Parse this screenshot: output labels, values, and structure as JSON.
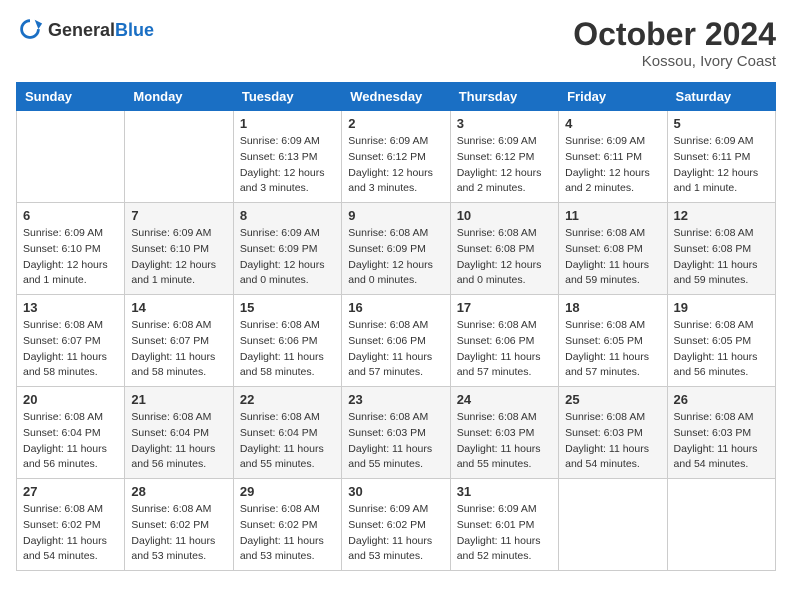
{
  "logo": {
    "general": "General",
    "blue": "Blue"
  },
  "header": {
    "month": "October 2024",
    "location": "Kossou, Ivory Coast"
  },
  "weekdays": [
    "Sunday",
    "Monday",
    "Tuesday",
    "Wednesday",
    "Thursday",
    "Friday",
    "Saturday"
  ],
  "weeks": [
    [
      {
        "day": "",
        "sunrise": "",
        "sunset": "",
        "daylight": ""
      },
      {
        "day": "",
        "sunrise": "",
        "sunset": "",
        "daylight": ""
      },
      {
        "day": "1",
        "sunrise": "Sunrise: 6:09 AM",
        "sunset": "Sunset: 6:13 PM",
        "daylight": "Daylight: 12 hours and 3 minutes."
      },
      {
        "day": "2",
        "sunrise": "Sunrise: 6:09 AM",
        "sunset": "Sunset: 6:12 PM",
        "daylight": "Daylight: 12 hours and 3 minutes."
      },
      {
        "day": "3",
        "sunrise": "Sunrise: 6:09 AM",
        "sunset": "Sunset: 6:12 PM",
        "daylight": "Daylight: 12 hours and 2 minutes."
      },
      {
        "day": "4",
        "sunrise": "Sunrise: 6:09 AM",
        "sunset": "Sunset: 6:11 PM",
        "daylight": "Daylight: 12 hours and 2 minutes."
      },
      {
        "day": "5",
        "sunrise": "Sunrise: 6:09 AM",
        "sunset": "Sunset: 6:11 PM",
        "daylight": "Daylight: 12 hours and 1 minute."
      }
    ],
    [
      {
        "day": "6",
        "sunrise": "Sunrise: 6:09 AM",
        "sunset": "Sunset: 6:10 PM",
        "daylight": "Daylight: 12 hours and 1 minute."
      },
      {
        "day": "7",
        "sunrise": "Sunrise: 6:09 AM",
        "sunset": "Sunset: 6:10 PM",
        "daylight": "Daylight: 12 hours and 1 minute."
      },
      {
        "day": "8",
        "sunrise": "Sunrise: 6:09 AM",
        "sunset": "Sunset: 6:09 PM",
        "daylight": "Daylight: 12 hours and 0 minutes."
      },
      {
        "day": "9",
        "sunrise": "Sunrise: 6:08 AM",
        "sunset": "Sunset: 6:09 PM",
        "daylight": "Daylight: 12 hours and 0 minutes."
      },
      {
        "day": "10",
        "sunrise": "Sunrise: 6:08 AM",
        "sunset": "Sunset: 6:08 PM",
        "daylight": "Daylight: 12 hours and 0 minutes."
      },
      {
        "day": "11",
        "sunrise": "Sunrise: 6:08 AM",
        "sunset": "Sunset: 6:08 PM",
        "daylight": "Daylight: 11 hours and 59 minutes."
      },
      {
        "day": "12",
        "sunrise": "Sunrise: 6:08 AM",
        "sunset": "Sunset: 6:08 PM",
        "daylight": "Daylight: 11 hours and 59 minutes."
      }
    ],
    [
      {
        "day": "13",
        "sunrise": "Sunrise: 6:08 AM",
        "sunset": "Sunset: 6:07 PM",
        "daylight": "Daylight: 11 hours and 58 minutes."
      },
      {
        "day": "14",
        "sunrise": "Sunrise: 6:08 AM",
        "sunset": "Sunset: 6:07 PM",
        "daylight": "Daylight: 11 hours and 58 minutes."
      },
      {
        "day": "15",
        "sunrise": "Sunrise: 6:08 AM",
        "sunset": "Sunset: 6:06 PM",
        "daylight": "Daylight: 11 hours and 58 minutes."
      },
      {
        "day": "16",
        "sunrise": "Sunrise: 6:08 AM",
        "sunset": "Sunset: 6:06 PM",
        "daylight": "Daylight: 11 hours and 57 minutes."
      },
      {
        "day": "17",
        "sunrise": "Sunrise: 6:08 AM",
        "sunset": "Sunset: 6:06 PM",
        "daylight": "Daylight: 11 hours and 57 minutes."
      },
      {
        "day": "18",
        "sunrise": "Sunrise: 6:08 AM",
        "sunset": "Sunset: 6:05 PM",
        "daylight": "Daylight: 11 hours and 57 minutes."
      },
      {
        "day": "19",
        "sunrise": "Sunrise: 6:08 AM",
        "sunset": "Sunset: 6:05 PM",
        "daylight": "Daylight: 11 hours and 56 minutes."
      }
    ],
    [
      {
        "day": "20",
        "sunrise": "Sunrise: 6:08 AM",
        "sunset": "Sunset: 6:04 PM",
        "daylight": "Daylight: 11 hours and 56 minutes."
      },
      {
        "day": "21",
        "sunrise": "Sunrise: 6:08 AM",
        "sunset": "Sunset: 6:04 PM",
        "daylight": "Daylight: 11 hours and 56 minutes."
      },
      {
        "day": "22",
        "sunrise": "Sunrise: 6:08 AM",
        "sunset": "Sunset: 6:04 PM",
        "daylight": "Daylight: 11 hours and 55 minutes."
      },
      {
        "day": "23",
        "sunrise": "Sunrise: 6:08 AM",
        "sunset": "Sunset: 6:03 PM",
        "daylight": "Daylight: 11 hours and 55 minutes."
      },
      {
        "day": "24",
        "sunrise": "Sunrise: 6:08 AM",
        "sunset": "Sunset: 6:03 PM",
        "daylight": "Daylight: 11 hours and 55 minutes."
      },
      {
        "day": "25",
        "sunrise": "Sunrise: 6:08 AM",
        "sunset": "Sunset: 6:03 PM",
        "daylight": "Daylight: 11 hours and 54 minutes."
      },
      {
        "day": "26",
        "sunrise": "Sunrise: 6:08 AM",
        "sunset": "Sunset: 6:03 PM",
        "daylight": "Daylight: 11 hours and 54 minutes."
      }
    ],
    [
      {
        "day": "27",
        "sunrise": "Sunrise: 6:08 AM",
        "sunset": "Sunset: 6:02 PM",
        "daylight": "Daylight: 11 hours and 54 minutes."
      },
      {
        "day": "28",
        "sunrise": "Sunrise: 6:08 AM",
        "sunset": "Sunset: 6:02 PM",
        "daylight": "Daylight: 11 hours and 53 minutes."
      },
      {
        "day": "29",
        "sunrise": "Sunrise: 6:08 AM",
        "sunset": "Sunset: 6:02 PM",
        "daylight": "Daylight: 11 hours and 53 minutes."
      },
      {
        "day": "30",
        "sunrise": "Sunrise: 6:09 AM",
        "sunset": "Sunset: 6:02 PM",
        "daylight": "Daylight: 11 hours and 53 minutes."
      },
      {
        "day": "31",
        "sunrise": "Sunrise: 6:09 AM",
        "sunset": "Sunset: 6:01 PM",
        "daylight": "Daylight: 11 hours and 52 minutes."
      },
      {
        "day": "",
        "sunrise": "",
        "sunset": "",
        "daylight": ""
      },
      {
        "day": "",
        "sunrise": "",
        "sunset": "",
        "daylight": ""
      }
    ]
  ]
}
